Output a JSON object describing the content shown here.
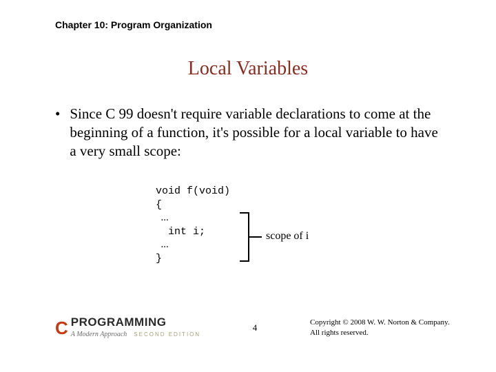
{
  "chapter": "Chapter 10: Program Organization",
  "title": "Local Variables",
  "bullet": "Since C 99 doesn't require variable declarations to come at the beginning of a function, it's possible for a local variable to have a very small scope:",
  "code": {
    "l1": "void f(void)",
    "l2": "{",
    "l3": "  ...",
    "l4": "  int i;",
    "l5": "  ...",
    "l6": "}"
  },
  "bracket_label": "scope of i",
  "logo": {
    "c": "C",
    "programming": "PROGRAMMING",
    "subtitle": "A Modern Approach",
    "edition": "SECOND EDITION"
  },
  "page_number": "4",
  "copyright": "Copyright © 2008 W. W. Norton & Company. All rights reserved."
}
